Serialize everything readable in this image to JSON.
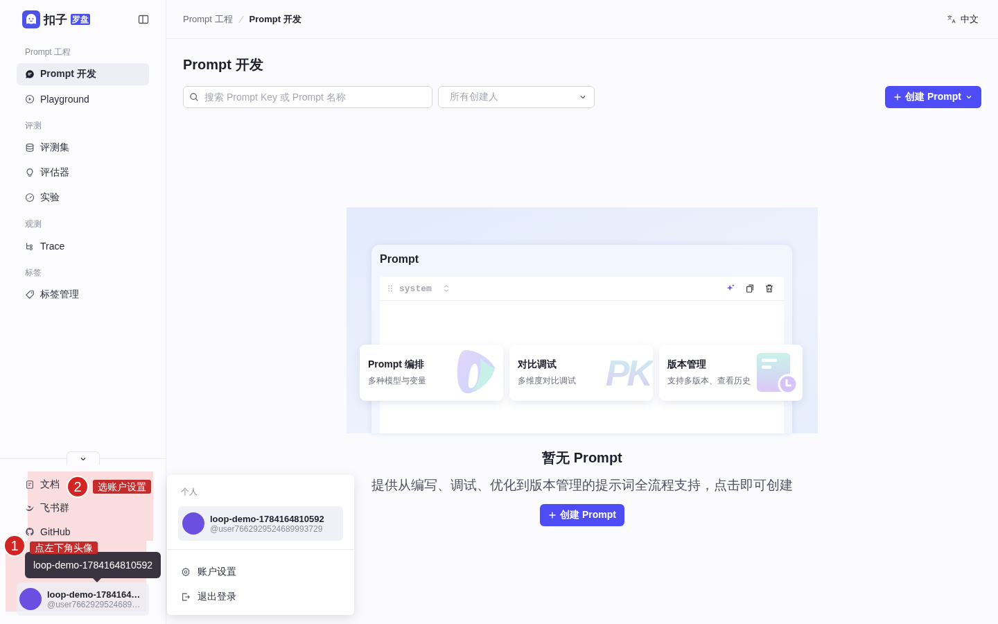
{
  "sidebar": {
    "logo": {
      "name": "扣子",
      "badge": "罗盘"
    },
    "groups": [
      {
        "title": "Prompt 工程",
        "items": [
          {
            "label": "Prompt 开发",
            "kind": "chat",
            "selected": true
          },
          {
            "label": "Playground",
            "kind": "play",
            "selected": false
          }
        ]
      },
      {
        "title": "评测",
        "items": [
          {
            "label": "评测集",
            "kind": "database",
            "selected": false
          },
          {
            "label": "评估器",
            "kind": "bulb",
            "selected": false
          },
          {
            "label": "实验",
            "kind": "gauge",
            "selected": false
          }
        ]
      },
      {
        "title": "观测",
        "items": [
          {
            "label": "Trace",
            "kind": "tree",
            "selected": false
          }
        ]
      },
      {
        "title": "标签",
        "items": [
          {
            "label": "标签管理",
            "kind": "tag",
            "selected": false
          }
        ]
      }
    ],
    "footer_links": [
      {
        "label": "文档",
        "kind": "doc"
      },
      {
        "label": "飞书群",
        "kind": "bird"
      },
      {
        "label": "GitHub",
        "kind": "github"
      }
    ],
    "tooltip": "loop-demo-1784164810592",
    "user": {
      "name": "loop-demo-1784164…",
      "handle": "@user7662929524689…"
    }
  },
  "header": {
    "breadcrumb": [
      {
        "label": "Prompt 工程",
        "selected": false
      },
      {
        "label": "Prompt 开发",
        "selected": true
      }
    ],
    "language": "中文"
  },
  "page": {
    "title": "Prompt 开发",
    "search": {
      "placeholder": "搜索 Prompt Key 或 Prompt 名称"
    },
    "creator_filter": {
      "placeholder": "所有创建人"
    },
    "create_button": "创建 Prompt"
  },
  "empty_state": {
    "illustration": {
      "title": "Prompt",
      "role": "system",
      "features": [
        {
          "title": "Prompt 编排",
          "subtitle": "多种模型与变量",
          "kind": "orchestrate"
        },
        {
          "title": "对比调试",
          "subtitle": "多维度对比调试",
          "kind": "pk",
          "art_text": "PK"
        },
        {
          "title": "版本管理",
          "subtitle": "支持多版本、查看历史",
          "kind": "version"
        }
      ]
    },
    "title": "暂无 Prompt",
    "description": "提供从编写、调试、优化到版本管理的提示词全流程支持，点击即可创建",
    "button": "创建 Prompt"
  },
  "account_menu": {
    "section": "个人",
    "user": {
      "name": "loop-demo-1784164810592",
      "handle": "@user7662929524689993729"
    },
    "items": [
      {
        "label": "账户设置",
        "kind": "gear"
      },
      {
        "label": "退出登录",
        "kind": "logout"
      }
    ]
  },
  "annotations": [
    {
      "number": "2",
      "label": "选账户设置"
    },
    {
      "number": "1",
      "label": "点左下角头像"
    }
  ]
}
